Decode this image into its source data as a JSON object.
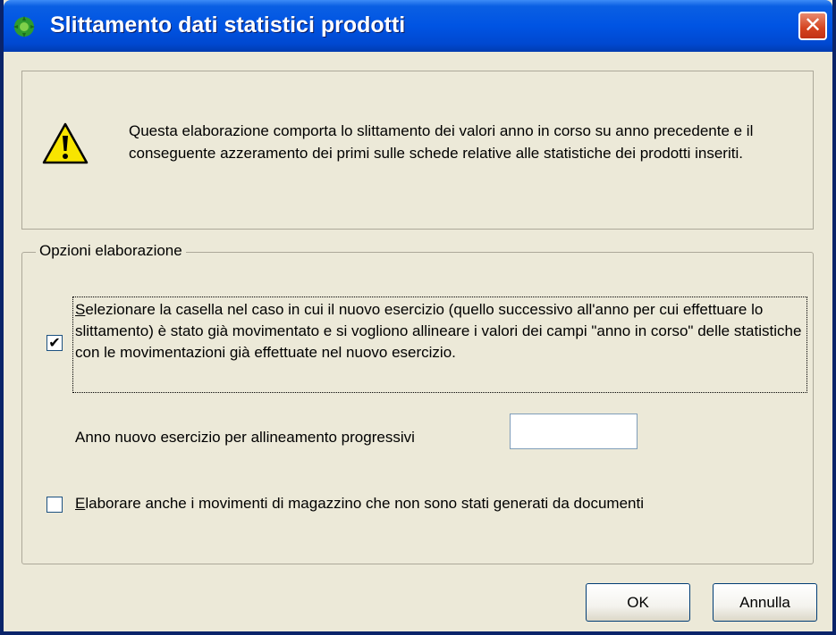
{
  "window": {
    "title": "Slittamento dati statistici prodotti",
    "close_glyph": "✕"
  },
  "info": {
    "icon": "warning-icon",
    "text": "Questa elaborazione comporta lo slittamento dei valori anno in corso su anno precedente e il conseguente azzeramento dei primi sulle schede relative alle statistiche dei prodotti inseriti."
  },
  "options": {
    "legend": "Opzioni elaborazione",
    "align_checkbox": {
      "checked": true,
      "check_glyph": "✔",
      "label_first": "S",
      "label_rest": "elezionare la casella nel caso in cui il nuovo esercizio (quello successivo all'anno per cui effettuare lo slittamento) è stato già movimentato e si vogliono allineare i valori dei campi \"anno in corso\" delle statistiche con le movimentazioni già effettuate nel nuovo esercizio."
    },
    "year": {
      "label": "Anno nuovo esercizio per allineamento progressivi",
      "value": ""
    },
    "warehouse_checkbox": {
      "checked": false,
      "label_first": "E",
      "label_rest": "laborare anche i movimenti di magazzino che non sono stati generati da documenti"
    }
  },
  "buttons": {
    "ok": "OK",
    "cancel": "Annulla"
  },
  "colors": {
    "titlebar": "#0054e3",
    "dialog_bg": "#ece9d8",
    "close_button": "#d4431f"
  }
}
